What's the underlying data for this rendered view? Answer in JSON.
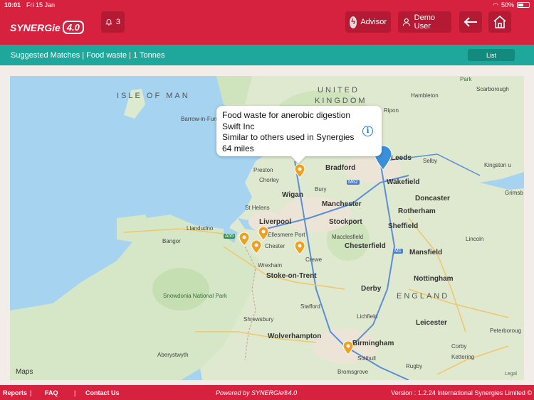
{
  "status": {
    "time": "10:01",
    "date": "Fri 15 Jan",
    "battery": "50%"
  },
  "header": {
    "logo_text": "SYNERGie",
    "logo_badge": "4.0",
    "notification_count": "3",
    "advisor_label": "Advisor",
    "user_label": "Demo User"
  },
  "subbar": {
    "title": "Suggested Matches  | Food waste | 1 Tonnes",
    "list_button": "List"
  },
  "callout": {
    "line1": "Food waste for anerobic digestion",
    "line2": "Swift Inc",
    "line3": "Similar to others used in Synergies",
    "line4": "64 miles"
  },
  "map": {
    "places": {
      "isle_of_man": "ISLE OF MAN",
      "united_kingdom_1": "UNITED",
      "united_kingdom_2": "KINGDOM",
      "barrow": "Barrow-in-Furness",
      "preston": "Preston",
      "chorley": "Chorley",
      "bradford": "Bradford",
      "leeds": "Leeds",
      "wigan": "Wigan",
      "bury": "Bury",
      "wakefield": "Wakefield",
      "doncaster": "Doncaster",
      "st_helens": "St Helens",
      "manchester": "Manchester",
      "rotherham": "Rotherham",
      "liverpool": "Liverpool",
      "stockport": "Stockport",
      "sheffield": "Sheffield",
      "llandudno": "Llandudno",
      "ellesmere": "Ellesmere Port",
      "macclesfield": "Macclesfield",
      "bangor": "Bangor",
      "chester": "Chester",
      "chesterfield": "Chesterfield",
      "mansfield": "Mansfield",
      "lincoln": "Lincoln",
      "crewe": "Crewe",
      "wrexham": "Wrexham",
      "stoke": "Stoke-on-Trent",
      "nottingham": "Nottingham",
      "snowdonia": "Snowdonia National Park",
      "derby": "Derby",
      "england": "ENGLAND",
      "stafford": "Stafford",
      "lichfield": "Lichfield",
      "leicester": "Leicester",
      "shrewsbury": "Shrewsbury",
      "wolverhampton": "Wolverhampton",
      "birmingham": "Birmingham",
      "aberystwyth": "Aberystwyth",
      "solihull": "Solihull",
      "rugby": "Rugby",
      "corby": "Corby",
      "kettering": "Kettering",
      "bromsgrove": "Bromsgrove",
      "peterborough": "Peterboroug",
      "hambleton": "Hambleton",
      "scarborough": "Scarborough",
      "ripon": "Ripon",
      "selby": "Selby",
      "kingston": "Kingston u",
      "grimsby": "Grimsb",
      "york_park": "Park"
    },
    "road_labels": {
      "m62": "M62",
      "m1": "M1",
      "a55": "A55"
    },
    "attribution": "Maps",
    "legal": "Legal"
  },
  "footer": {
    "reports": "Reports",
    "faq": "FAQ",
    "contact": "Contact Us",
    "powered": "Powered by SYNERGie®4.0",
    "version": "Version : 1.2.24  International Synergies Limited ©"
  },
  "colors": {
    "brand_red": "#d6213f",
    "teal": "#1ea89b",
    "pin_orange": "#f0a020",
    "pin_blue": "#3a8fd8"
  }
}
